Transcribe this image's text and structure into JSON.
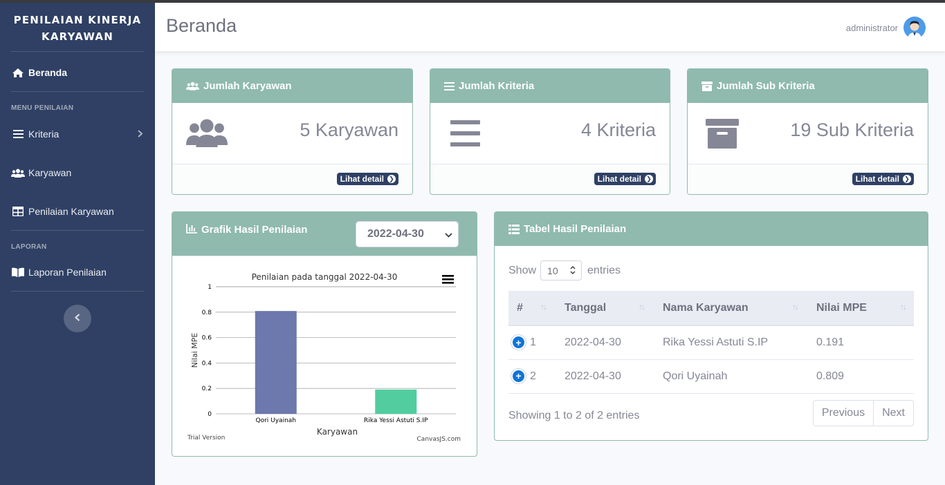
{
  "sidebar": {
    "brand": "PENILAIAN KINERJA KARYAWAN",
    "items": [
      {
        "label": "Beranda",
        "icon": "home-icon"
      },
      {
        "label": "Kriteria",
        "icon": "bars-icon"
      },
      {
        "label": "Karyawan",
        "icon": "users-icon"
      },
      {
        "label": "Penilaian Karyawan",
        "icon": "table-icon"
      },
      {
        "label": "Laporan Penilaian",
        "icon": "book-icon"
      }
    ],
    "headings": [
      "MENU PENILAIAN",
      "LAPORAN"
    ]
  },
  "topbar": {
    "title": "Beranda",
    "user": "administrator"
  },
  "stats": [
    {
      "title": "Jumlah Karyawan",
      "value": "5 Karyawan",
      "button": "Lihat detail"
    },
    {
      "title": "Jumlah Kriteria",
      "value": "4 Kriteria",
      "button": "Lihat detail"
    },
    {
      "title": "Jumlah Sub Kriteria",
      "value": "19 Sub Kriteria",
      "button": "Lihat detail"
    }
  ],
  "chart_panel": {
    "title": "Grafik Hasil Penilaian",
    "selected_date": "2022-04-30",
    "trial": "Trial Version",
    "credit": "CanvasJS.com"
  },
  "chart_data": {
    "type": "bar",
    "title": "Penilaian pada tanggal 2022-04-30",
    "xlabel": "Karyawan",
    "ylabel": "Nilai MPE",
    "categories": [
      "Qori Uyainah",
      "Rika Yessi Astuti S.IP"
    ],
    "values": [
      0.809,
      0.191
    ],
    "ylim": [
      0,
      1
    ],
    "yticks": [
      "0",
      "0.2",
      "0.4",
      "0.6",
      "0.8",
      "1"
    ],
    "colors": [
      "#6d78ad",
      "#51cda0"
    ]
  },
  "table_panel": {
    "title": "Tabel Hasil Penilaian",
    "show": "Show",
    "entries_value": "10",
    "entries": "entries",
    "columns": [
      "#",
      "Tanggal",
      "Nama Karyawan",
      "Nilai MPE"
    ],
    "rows": [
      {
        "no": "1",
        "tanggal": "2022-04-30",
        "nama": "Rika Yessi Astuti S.IP",
        "nilai": "0.191"
      },
      {
        "no": "2",
        "tanggal": "2022-04-30",
        "nama": "Qori Uyainah",
        "nilai": "0.809"
      }
    ],
    "info": "Showing 1 to 2 of 2 entries",
    "prev": "Previous",
    "next": "Next"
  }
}
